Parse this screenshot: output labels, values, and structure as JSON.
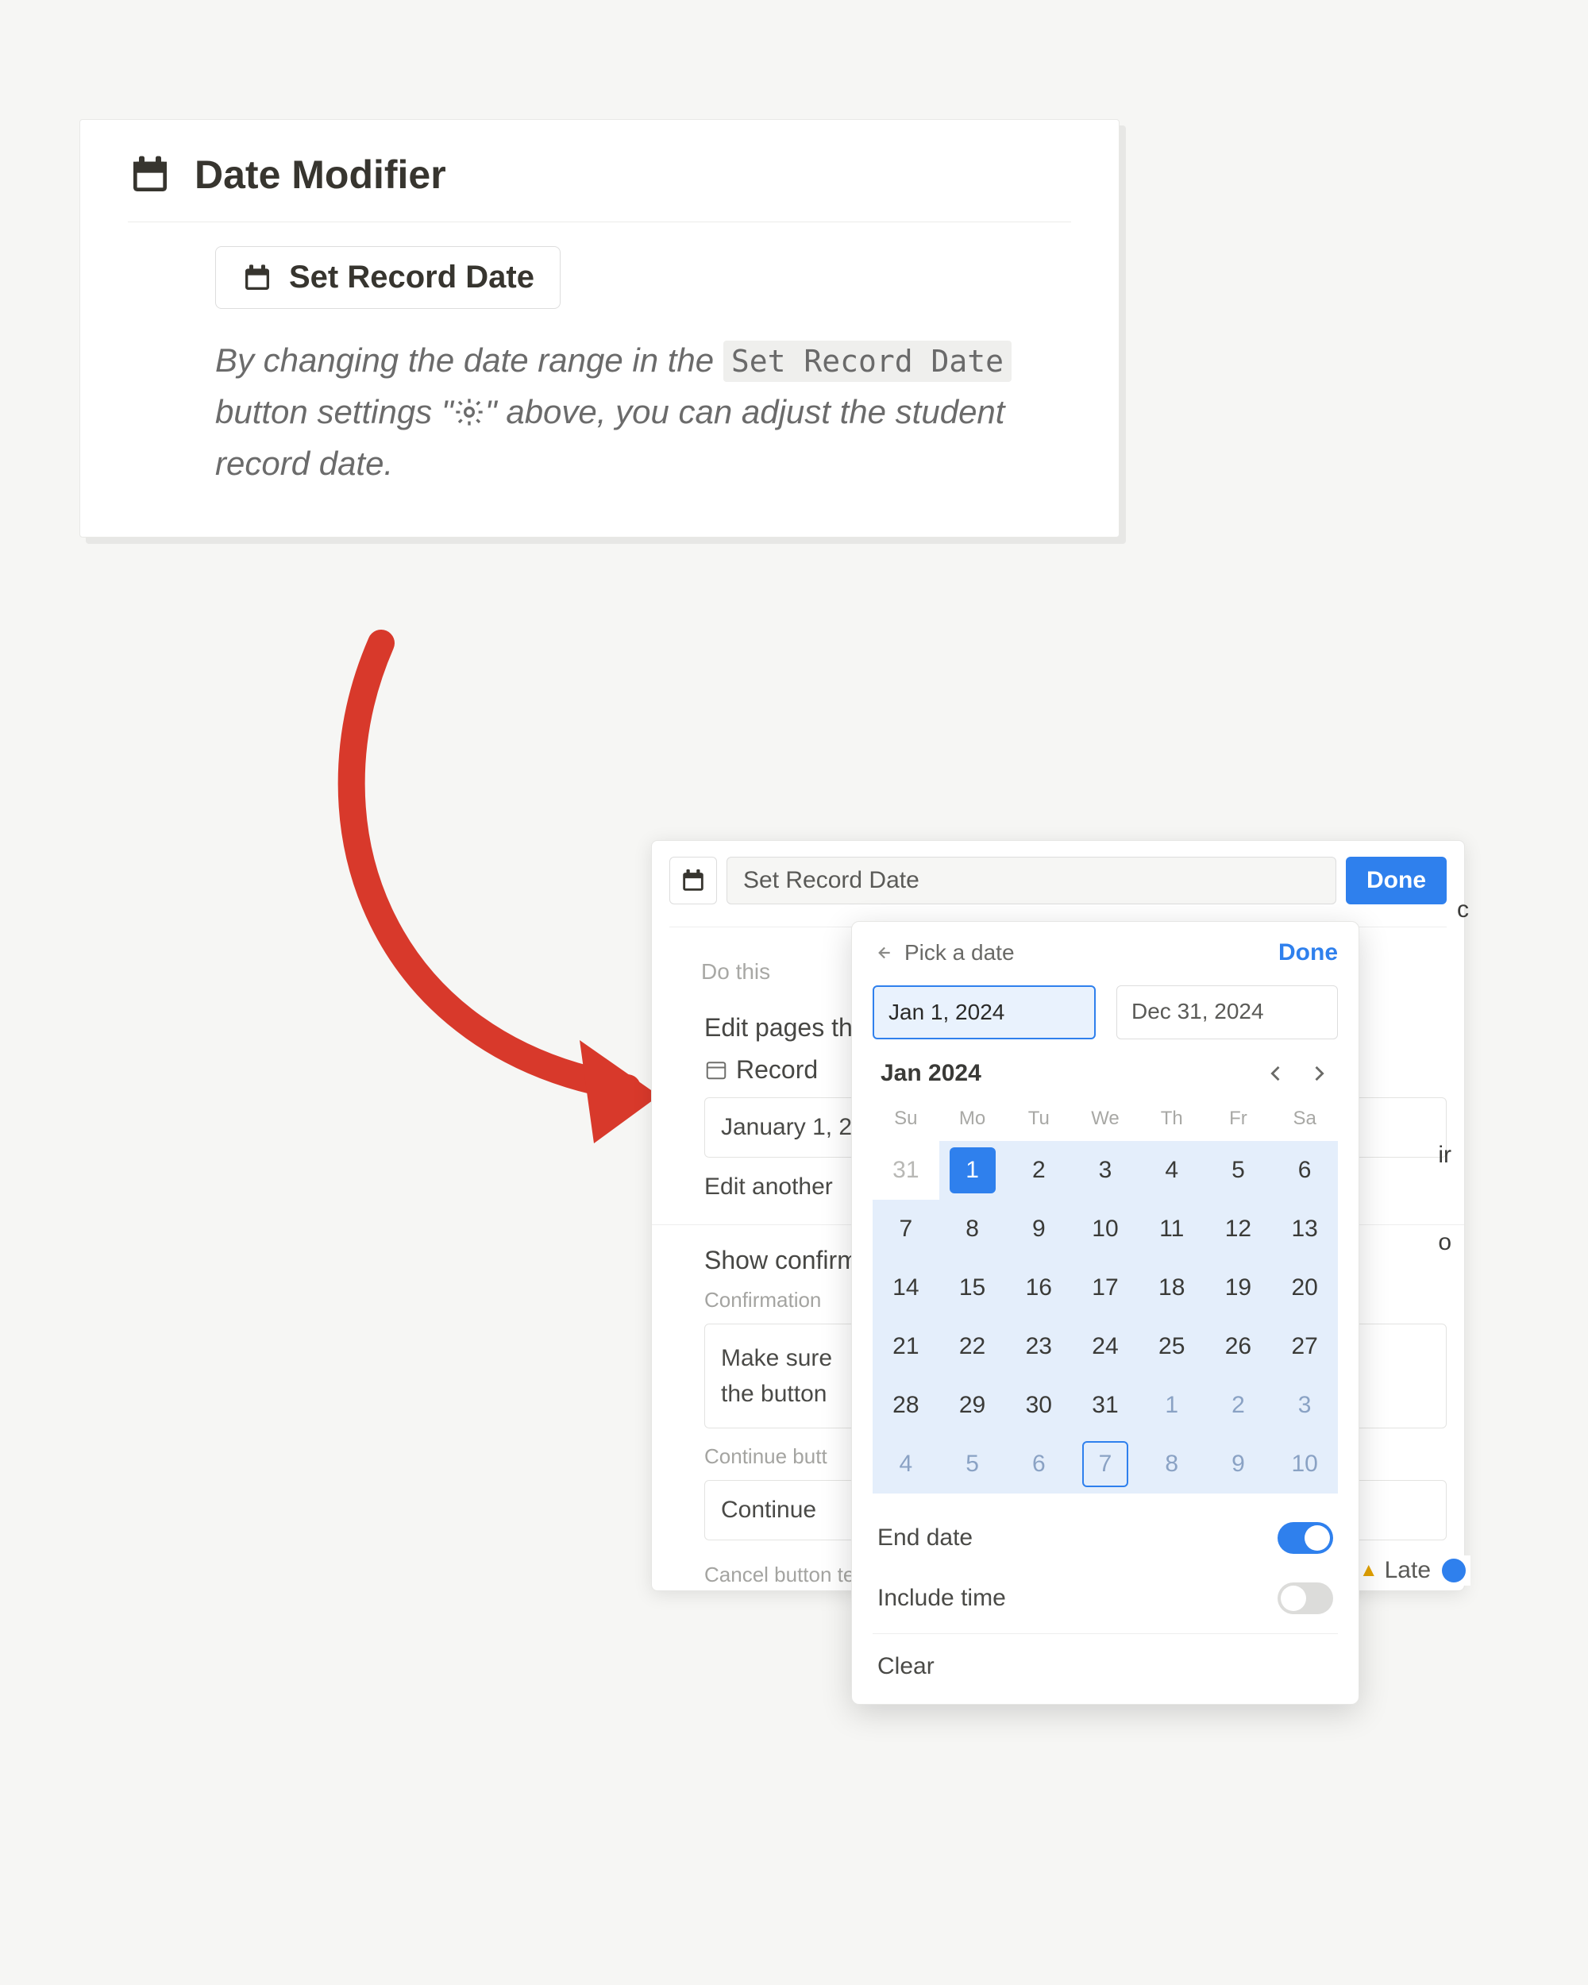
{
  "top": {
    "title": "Date Modifier",
    "button_label": "Set Record Date",
    "desc_1": "By changing the date range in the ",
    "chip": "Set Record Date",
    "desc_2": " button settings \"",
    "desc_3": "\" above, you can adjust the student record date."
  },
  "editor": {
    "title_value": "Set Record Date",
    "done": "Done",
    "do_this": "Do this",
    "edit_pages": "Edit pages th",
    "record_label": "Record",
    "record_value": "January 1, 2",
    "edit_another": "Edit another",
    "show_confirm": "Show confirm",
    "confirmation_label": "Confirmation",
    "confirm_text_1": "Make sure",
    "confirm_text_2": "the button",
    "continue_label": "Continue butt",
    "continue_value": "Continue",
    "cancel_label": "Cancel button text",
    "late": "Late"
  },
  "picker": {
    "pick_a_date": "Pick a date",
    "done": "Done",
    "start": "Jan 1, 2024",
    "end": "Dec 31, 2024",
    "month": "Jan 2024",
    "dow": [
      "Su",
      "Mo",
      "Tu",
      "We",
      "Th",
      "Fr",
      "Sa"
    ],
    "weeks": [
      [
        {
          "n": "31",
          "muted": true,
          "shade": false
        },
        {
          "n": "1",
          "shade": true,
          "selected": true
        },
        {
          "n": "2",
          "shade": true
        },
        {
          "n": "3",
          "shade": true
        },
        {
          "n": "4",
          "shade": true
        },
        {
          "n": "5",
          "shade": true
        },
        {
          "n": "6",
          "shade": true
        }
      ],
      [
        {
          "n": "7",
          "shade": true
        },
        {
          "n": "8",
          "shade": true
        },
        {
          "n": "9",
          "shade": true
        },
        {
          "n": "10",
          "shade": true
        },
        {
          "n": "11",
          "shade": true
        },
        {
          "n": "12",
          "shade": true
        },
        {
          "n": "13",
          "shade": true
        }
      ],
      [
        {
          "n": "14",
          "shade": true
        },
        {
          "n": "15",
          "shade": true
        },
        {
          "n": "16",
          "shade": true
        },
        {
          "n": "17",
          "shade": true
        },
        {
          "n": "18",
          "shade": true
        },
        {
          "n": "19",
          "shade": true
        },
        {
          "n": "20",
          "shade": true
        }
      ],
      [
        {
          "n": "21",
          "shade": true
        },
        {
          "n": "22",
          "shade": true
        },
        {
          "n": "23",
          "shade": true
        },
        {
          "n": "24",
          "shade": true
        },
        {
          "n": "25",
          "shade": true
        },
        {
          "n": "26",
          "shade": true
        },
        {
          "n": "27",
          "shade": true
        }
      ],
      [
        {
          "n": "28",
          "shade": true
        },
        {
          "n": "29",
          "shade": true
        },
        {
          "n": "30",
          "shade": true
        },
        {
          "n": "31",
          "shade": true
        },
        {
          "n": "1",
          "muted": true,
          "shade": true
        },
        {
          "n": "2",
          "muted": true,
          "shade": true
        },
        {
          "n": "3",
          "muted": true,
          "shade": true
        }
      ],
      [
        {
          "n": "4",
          "muted": true,
          "shade": true
        },
        {
          "n": "5",
          "muted": true,
          "shade": true
        },
        {
          "n": "6",
          "muted": true,
          "shade": true
        },
        {
          "n": "7",
          "muted": true,
          "shade": true,
          "today": true
        },
        {
          "n": "8",
          "muted": true,
          "shade": true
        },
        {
          "n": "9",
          "muted": true,
          "shade": true
        },
        {
          "n": "10",
          "muted": true,
          "shade": true
        }
      ]
    ],
    "end_date_label": "End date",
    "include_time_label": "Include time",
    "clear": "Clear"
  }
}
